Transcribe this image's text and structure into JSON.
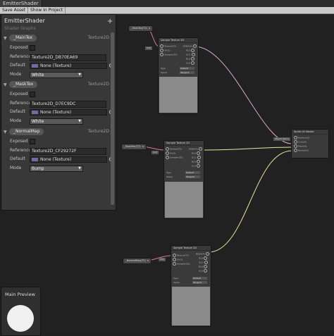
{
  "window": {
    "tab_title": "EmitterShader"
  },
  "toolbar": {
    "save_label": "Save Asset",
    "show_label": "Show In Project"
  },
  "blackboard": {
    "title": "EmitterShader",
    "subtitle": "Shader Graphs",
    "add_symbol": "+",
    "properties": [
      {
        "name": "_MainTex",
        "type": "Texture2D",
        "exposed_label": "Exposed",
        "reference_label": "Reference",
        "reference": "Texture2D_DB70EA69",
        "default_label": "Default",
        "default_value": "None (Texture)",
        "mode_label": "Mode",
        "mode": "White"
      },
      {
        "name": "_MaskTex",
        "type": "Texture2D",
        "exposed_label": "Exposed",
        "reference_label": "Reference",
        "reference": "Texture2D_D7EC9DC",
        "default_label": "Default",
        "default_value": "None (Texture)",
        "mode_label": "Mode",
        "mode": "White"
      },
      {
        "name": "_NormalMap",
        "type": "Texture2D",
        "exposed_label": "Exposed",
        "reference_label": "Reference",
        "reference": "Texture2D_CF29272F",
        "default_label": "Default",
        "default_value": "None (Texture)",
        "mode_label": "Mode",
        "mode": "Bump"
      }
    ]
  },
  "nodes": {
    "sample1": {
      "title": "Sample Texture 2D",
      "prop": "_MainTex(T2)",
      "uv": "UV0",
      "in": [
        "Texture(T2)",
        "UV(2)",
        "Sampler(SS)"
      ],
      "out": [
        "RGBA(4)",
        "R(1)",
        "G(1)",
        "B(1)",
        "A(1)"
      ],
      "type_label": "Type",
      "type_value": "Default",
      "space_label": "Space",
      "space_value": "Tangent"
    },
    "sample2": {
      "title": "Sample Texture 2D",
      "prop": "_MaskTex(T2)",
      "uv": "UV0",
      "in": [
        "Texture(T2)",
        "UV(2)",
        "Sampler(SS)"
      ],
      "out": [
        "RGBA(4)",
        "R(1)",
        "G(1)",
        "B(1)",
        "A(1)"
      ],
      "type_label": "Type",
      "type_value": "Default",
      "space_label": "Space",
      "space_value": "Tangent"
    },
    "sample3": {
      "title": "Sample Texture 2D",
      "prop": "_NormalMap(T2)",
      "uv": "UV0",
      "in": [
        "Texture(T2)",
        "UV(2)",
        "Sampler(SS)"
      ],
      "out": [
        "RGBA(4)",
        "R(1)",
        "G(1)",
        "B(1)",
        "A(1)"
      ],
      "type_label": "Type",
      "type_value": "Default",
      "space_label": "Space",
      "space_value": "Tangent"
    },
    "master": {
      "title": "Sprite Lit Master",
      "pos_label": "Object Space",
      "in": [
        "Position(3)",
        "Color(4)",
        "Mask(4)",
        "Normal(3)"
      ]
    }
  },
  "main_preview": {
    "title": "Main Preview"
  },
  "colors": {
    "canvas": "#212121",
    "panel": "#383838",
    "edge_pink": "#e07a9a",
    "edge_yellow": "#e8e8a0",
    "thumb": "#7a67a8"
  }
}
